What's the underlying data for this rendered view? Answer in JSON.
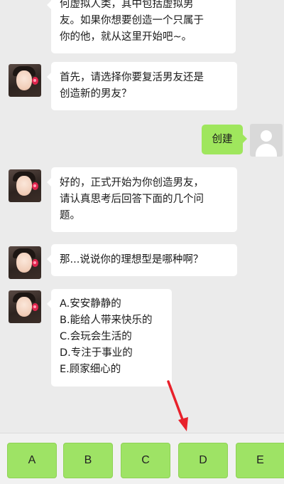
{
  "messages": {
    "m1": [
      "何虚拟人类，其中包括虚拟男",
      "友。如果你想要创造一个只属于",
      "你的他，就从这里开始吧~。"
    ],
    "m2": [
      "首先，请选择你要复活男友还是",
      "创造新的男友？"
    ],
    "user_reply": "创建",
    "m3": [
      "好的，正式开始为你创造男友，",
      "请认真思考后回答下面的几个问",
      "题。"
    ],
    "m4": [
      "那...说说你的理想型是哪种啊？"
    ],
    "m5": [
      "A.安安静静的",
      "B.能给人带来快乐的",
      "C.会玩会生活的",
      "D.专注于事业的",
      "E.顾家细心的"
    ]
  },
  "options": [
    "A",
    "B",
    "C",
    "D",
    "E"
  ],
  "colors": {
    "background": "#ebebeb",
    "bubble_in": "#ffffff",
    "bubble_out": "#9fe65d",
    "option_button": "#9ee365",
    "arrow": "#e8212b"
  },
  "icons": {
    "bot_avatar": "anime-girl-avatar",
    "user_avatar": "default-user-silhouette",
    "pointer": "red-arrow-down"
  }
}
